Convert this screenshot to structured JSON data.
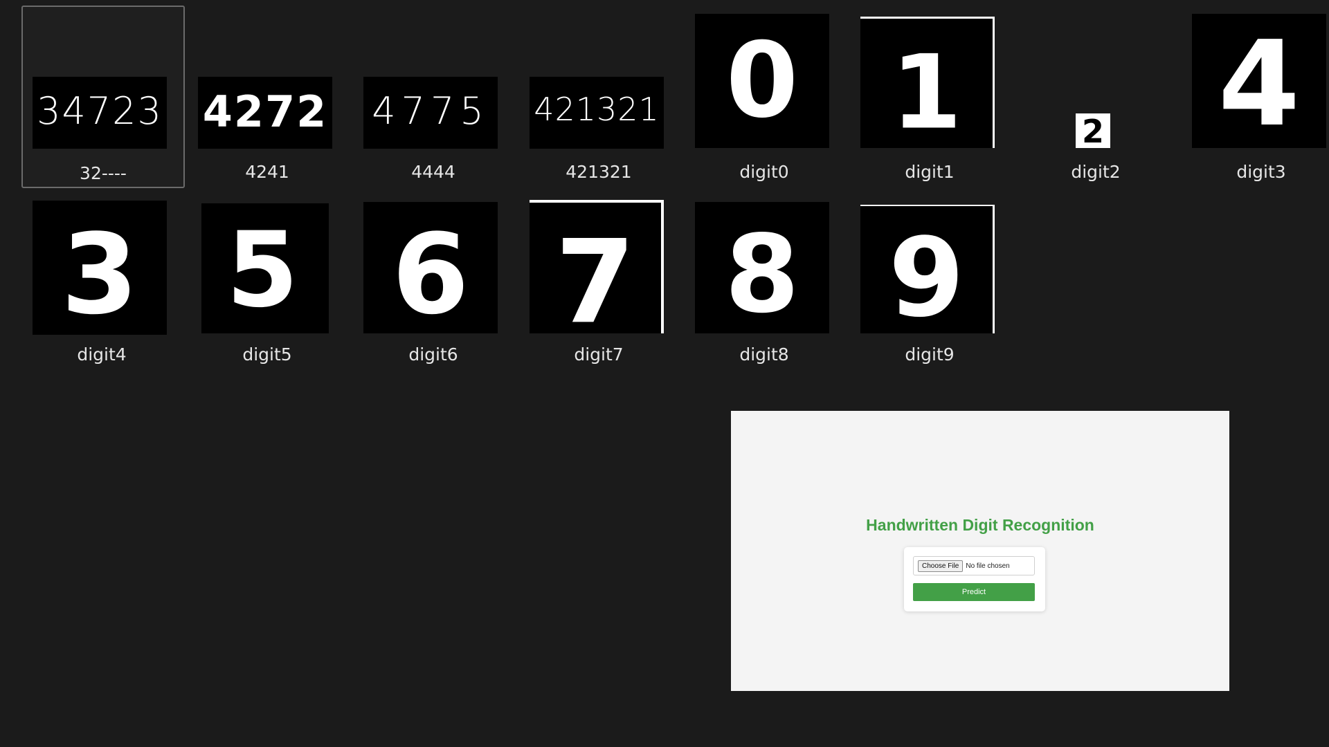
{
  "files": [
    {
      "name": "32----",
      "glyph": "34723",
      "selected": true
    },
    {
      "name": "4241",
      "glyph": "4272"
    },
    {
      "name": "4444",
      "glyph": "4775"
    },
    {
      "name": "421321",
      "glyph": "421321"
    },
    {
      "name": "digit0",
      "glyph": "0"
    },
    {
      "name": "digit1",
      "glyph": "1"
    },
    {
      "name": "digit2",
      "glyph": "2"
    },
    {
      "name": "digit3",
      "glyph": "4"
    },
    {
      "name": "digit4",
      "glyph": "3"
    },
    {
      "name": "digit5",
      "glyph": "5"
    },
    {
      "name": "digit6",
      "glyph": "6"
    },
    {
      "name": "digit7",
      "glyph": "7"
    },
    {
      "name": "digit8",
      "glyph": "8"
    },
    {
      "name": "digit9",
      "glyph": "9"
    }
  ],
  "app": {
    "title": "Handwritten Digit Recognition",
    "choose_file_label": "Choose File",
    "no_file_text": "No file chosen",
    "predict_label": "Predict"
  },
  "colors": {
    "background": "#1b1b1b",
    "accent_green": "#43a047",
    "app_background": "#f4f4f4"
  }
}
